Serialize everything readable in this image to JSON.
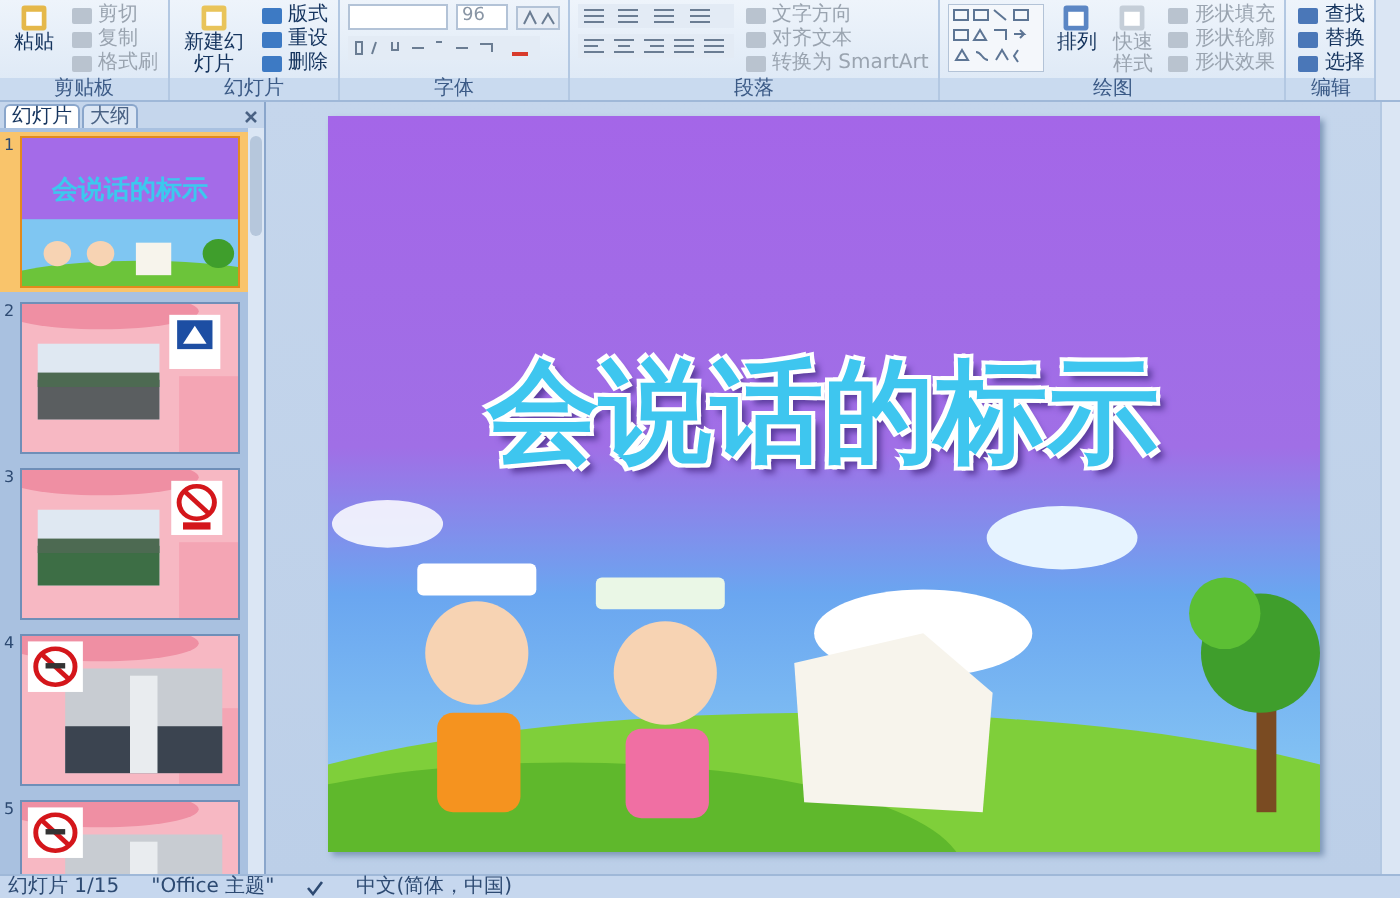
{
  "ribbon": {
    "groups": [
      {
        "kind": "clipboard",
        "name": "剪贴板",
        "big": {
          "label": "粘贴",
          "disabled": false
        },
        "items": [
          {
            "label": "剪切",
            "disabled": true
          },
          {
            "label": "复制",
            "disabled": true
          },
          {
            "label": "格式刷",
            "disabled": true
          }
        ]
      },
      {
        "kind": "slides",
        "name": "幻灯片",
        "big": {
          "label": "新建幻灯片",
          "disabled": false
        },
        "items": [
          {
            "label": "版式",
            "disabled": false
          },
          {
            "label": "重设",
            "disabled": false
          },
          {
            "label": "删除",
            "disabled": false
          }
        ]
      },
      {
        "kind": "font",
        "name": "字体",
        "font_size": "96"
      },
      {
        "kind": "paragraph",
        "name": "段落",
        "items": [
          {
            "label": "文字方向",
            "disabled": true
          },
          {
            "label": "对齐文本",
            "disabled": true
          },
          {
            "label": "转换为 SmartArt",
            "disabled": true
          }
        ]
      },
      {
        "kind": "drawing",
        "name": "绘图",
        "bigs": [
          {
            "label": "排列",
            "disabled": false
          },
          {
            "label": "快速样式",
            "disabled": true
          }
        ],
        "items": [
          {
            "label": "形状填充",
            "disabled": true
          },
          {
            "label": "形状轮廓",
            "disabled": true
          },
          {
            "label": "形状效果",
            "disabled": true
          }
        ]
      },
      {
        "kind": "editing",
        "name": "编辑",
        "items": [
          {
            "label": "查找",
            "disabled": false
          },
          {
            "label": "替换",
            "disabled": false
          },
          {
            "label": "选择",
            "disabled": false
          }
        ]
      }
    ]
  },
  "panel": {
    "tabs": [
      {
        "label": "幻灯片",
        "selected": true
      },
      {
        "label": "大纲",
        "selected": false
      }
    ],
    "slides": [
      {
        "number": "1",
        "selected": true,
        "kind": "title",
        "title": "会说话的标示"
      },
      {
        "number": "2",
        "selected": false
      },
      {
        "number": "3",
        "selected": false
      },
      {
        "number": "4",
        "selected": false
      },
      {
        "number": "5",
        "selected": false
      }
    ]
  },
  "slide": {
    "title": "会说话的标示"
  },
  "status_bar": {
    "slide": "幻灯片 1/15",
    "theme": "\"Office 主题\"",
    "language": "中文(简体，中国)"
  }
}
